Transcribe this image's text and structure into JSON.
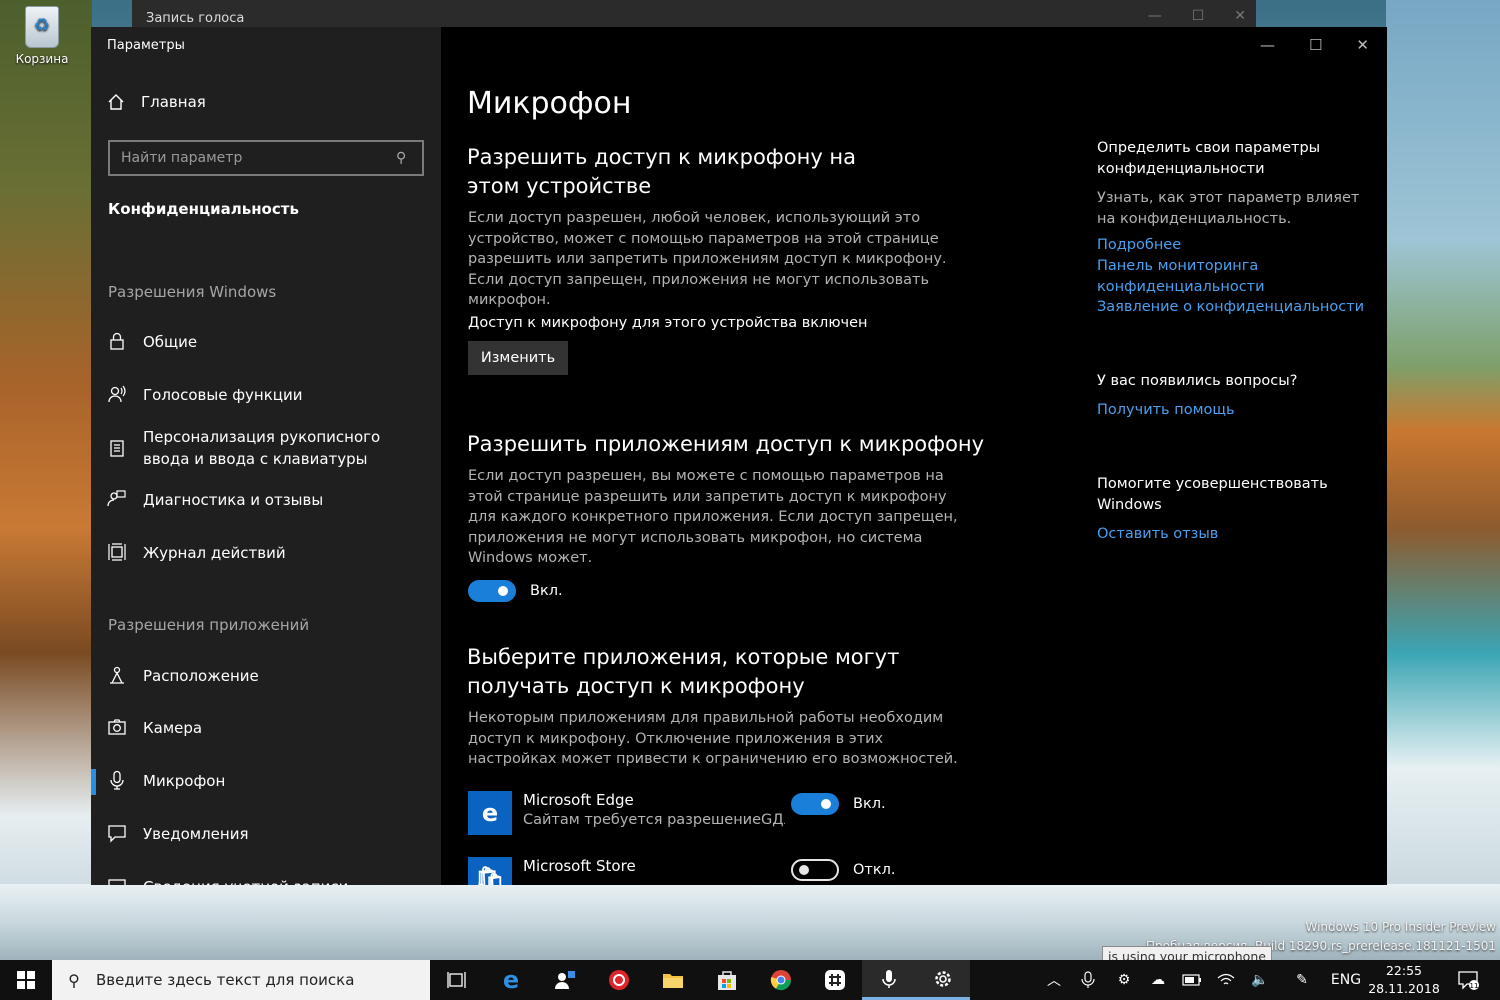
{
  "desktop": {
    "recycle_bin_label": "Корзина",
    "background_window_title": "Запись голоса",
    "watermark_line1": "Windows 10 Pro Insider Preview",
    "watermark_line2": "Пробная версия. Build 18290.rs_prerelease.181121-1501",
    "tooltip": "is using your microphone"
  },
  "window": {
    "app_title": "Параметры",
    "controls": {
      "minimize": "—",
      "maximize": "☐",
      "close": "✕"
    }
  },
  "sidebar": {
    "home_label": "Главная",
    "search_placeholder": "Найти параметр",
    "section_title": "Конфиденциальность",
    "windows_permissions_label": "Разрешения Windows",
    "app_permissions_label": "Разрешения приложений",
    "windows_items": [
      {
        "label": "Общие",
        "icon": "lock-icon"
      },
      {
        "label": "Голосовые функции",
        "icon": "speech-icon"
      },
      {
        "label": "Персонализация рукописного ввода и ввода с клавиатуры",
        "icon": "clipboard-icon"
      },
      {
        "label": "Диагностика и отзывы",
        "icon": "feedback-icon"
      },
      {
        "label": "Журнал действий",
        "icon": "timeline-icon"
      }
    ],
    "app_items": [
      {
        "label": "Расположение",
        "icon": "location-icon"
      },
      {
        "label": "Камера",
        "icon": "camera-icon"
      },
      {
        "label": "Микрофон",
        "icon": "microphone-icon"
      },
      {
        "label": "Уведомления",
        "icon": "notification-icon"
      },
      {
        "label": "Сведения учетной записи",
        "icon": "account-icon"
      }
    ],
    "active_item": "Микрофон"
  },
  "main": {
    "title": "Микрофон",
    "device_heading": "Разрешить доступ к микрофону на этом устройстве",
    "device_desc": "Если доступ разрешен, любой человек, использующий это устройство, может с помощью параметров на этой странице разрешить или запретить приложениям доступ к микрофону. Если доступ запрещен, приложения не могут использовать микрофон.",
    "device_status": "Доступ к микрофону для этого устройства включен",
    "change_button": "Изменить",
    "apps_heading": "Разрешить приложениям доступ к микрофону",
    "apps_desc": "Если доступ разрешен, вы можете с помощью параметров на этой странице разрешить или запретить доступ к микрофону для каждого конкретного приложения. Если доступ запрещен, приложения не могут использовать микрофон, но система Windows может.",
    "apps_toggle_label": "Вкл.",
    "choose_heading": "Выберите приложения, которые могут получать доступ к микрофону",
    "choose_desc": "Некоторым приложениям для правильной работы необходим доступ к микрофону. Отключение приложения в этих настройках может привести к ограничению его возможностей.",
    "apps": [
      {
        "name": "Microsoft Edge",
        "sub": "Сайтам требуется разрешениеGДл...",
        "state": "Вкл.",
        "on": true,
        "tile_color": "#0b63c1"
      },
      {
        "name": "Microsoft Store",
        "sub": "",
        "state": "Откл.",
        "on": false,
        "tile_color": "#0b63c1"
      }
    ]
  },
  "right_panel": {
    "privacy_heading": "Определить свои параметры конфиденциальности",
    "privacy_desc": "Узнать, как этот параметр влияет на конфиденциальность.",
    "link_more": "Подробнее",
    "link_dashboard": "Панель мониторинга конфиденциальности",
    "link_statement": "Заявление о конфиденциальности",
    "questions_heading": "У вас появились вопросы?",
    "link_help": "Получить помощь",
    "improve_heading": "Помогите усовершенствовать Windows",
    "link_feedback": "Оставить отзыв"
  },
  "taskbar": {
    "search_placeholder": "Введите здесь текст для поиска",
    "language": "ENG",
    "time": "22:55",
    "date": "28.11.2018",
    "notification_count": "11",
    "accent_color": "#1a7fd8"
  }
}
